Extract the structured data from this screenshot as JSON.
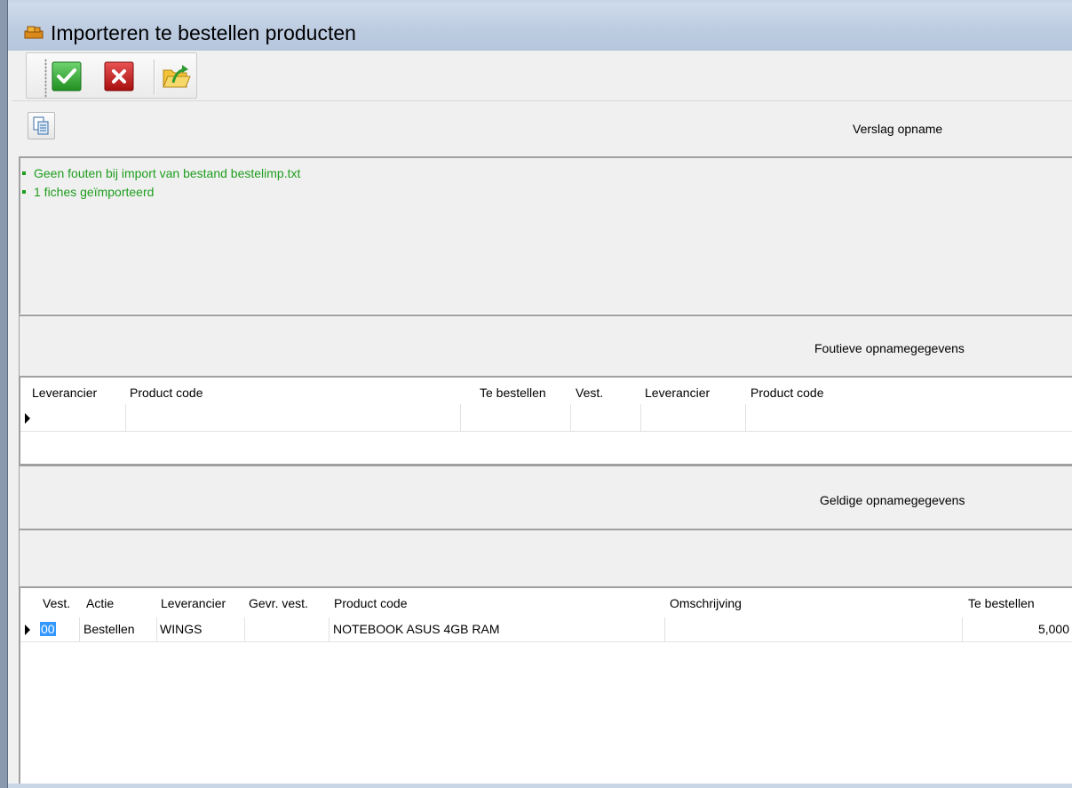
{
  "window": {
    "title": "Importeren te bestellen producten"
  },
  "toolbar": {
    "buttons": [
      {
        "icon": "checkmark-icon",
        "color": "#2aa52a"
      },
      {
        "icon": "close-icon",
        "color": "#cc1e1e"
      },
      {
        "icon": "folder-import-icon",
        "color": "#f2c23a"
      }
    ]
  },
  "report": {
    "heading": "Verslag opname",
    "messages": [
      "Geen fouten bij import van bestand bestelimp.txt",
      "1 fiches geïmporteerd"
    ],
    "message_color": "#1e9e1e"
  },
  "errors": {
    "heading": "Foutieve opnamegegevens",
    "columns": [
      "Leverancier",
      "Product code",
      "Te bestellen",
      "Vest.",
      "Leverancier",
      "Product code"
    ]
  },
  "valid": {
    "heading": "Geldige opnamegegevens",
    "columns": [
      "Vest.",
      "Actie",
      "Leverancier",
      "Gevr. vest.",
      "Product code",
      "Omschrijving",
      "Te bestellen"
    ],
    "rows": [
      {
        "vest": "00",
        "actie": "Bestellen",
        "leverancier": "WINGS",
        "gevr_vest": "",
        "product_code": "NOTEBOOK ASUS 4GB RAM",
        "omschrijving": "",
        "te_bestellen": "5,000"
      }
    ]
  }
}
